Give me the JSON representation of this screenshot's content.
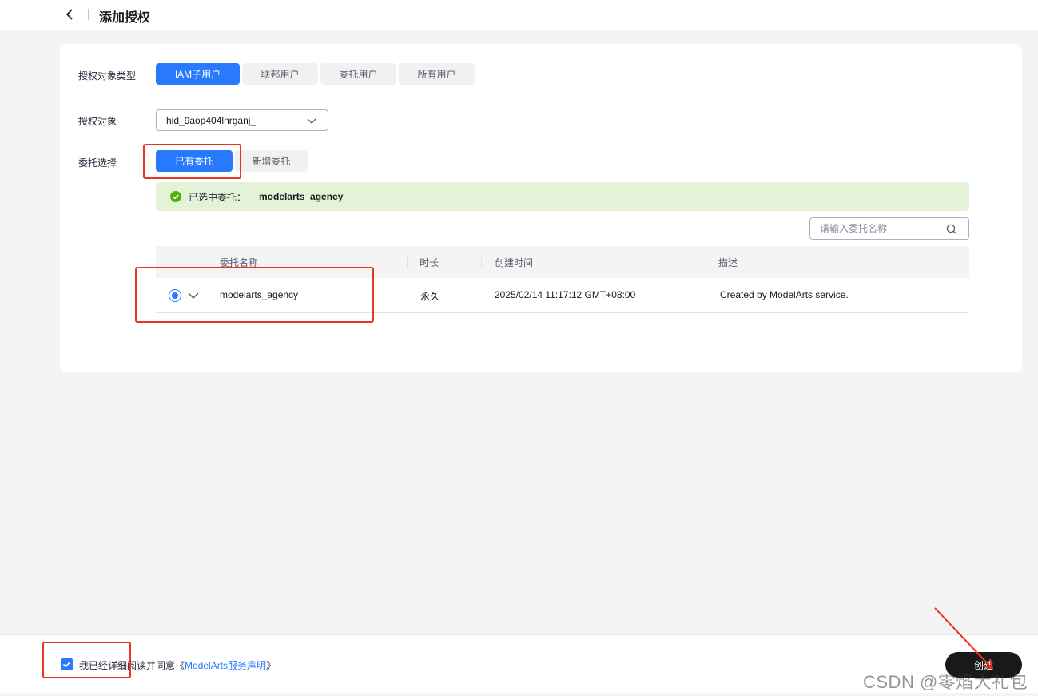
{
  "header": {
    "title": "添加授权"
  },
  "form": {
    "type_label": "授权对象类型",
    "type_options": [
      "IAM子用户",
      "联邦用户",
      "委托用户",
      "所有用户"
    ],
    "target_label": "授权对象",
    "target_value": "hid_9aop404lnrganj_",
    "agency_label": "委托选择",
    "agency_options": [
      "已有委托",
      "新增委托"
    ]
  },
  "notice": {
    "label": "已选中委托：",
    "value": "modelarts_agency"
  },
  "search": {
    "placeholder": "请输入委托名称"
  },
  "table": {
    "columns": [
      "委托名称",
      "时长",
      "创建时间",
      "描述"
    ],
    "rows": [
      {
        "name": "modelarts_agency",
        "duration": "永久",
        "created": "2025/02/14 11:17:12 GMT+08:00",
        "description": "Created by ModelArts service."
      }
    ]
  },
  "footer": {
    "agree_prefix": "我已经详细阅读并同意《",
    "agree_link": "ModelArts服务声明",
    "agree_suffix": "》",
    "create_label": "创建"
  },
  "watermark": "CSDN @零焰大礼包",
  "colors": {
    "primary": "#2979ff",
    "success_bg": "#e4f3d8",
    "success_icon": "#50b012",
    "highlight": "#ea3323"
  }
}
